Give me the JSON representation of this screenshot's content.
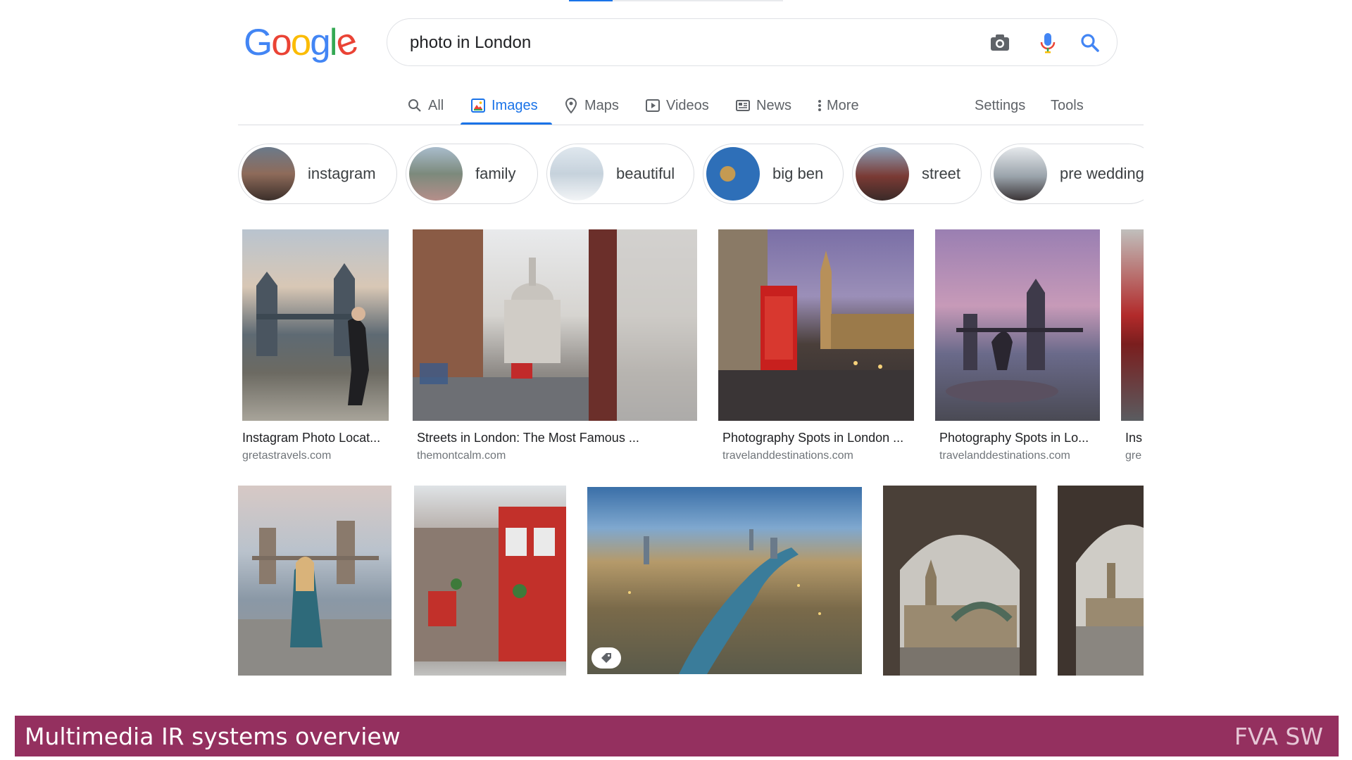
{
  "logo": {
    "letters": [
      {
        "ch": "G",
        "color": "#4285F4"
      },
      {
        "ch": "o",
        "color": "#EA4335"
      },
      {
        "ch": "o",
        "color": "#FBBC05"
      },
      {
        "ch": "g",
        "color": "#4285F4"
      },
      {
        "ch": "l",
        "color": "#34A853"
      },
      {
        "ch": "e",
        "color": "#EA4335"
      }
    ]
  },
  "search": {
    "query": "photo in London",
    "icons": [
      "camera-icon",
      "microphone-icon",
      "search-icon"
    ]
  },
  "tabs": [
    {
      "label": "All",
      "icon": "search-icon",
      "active": false
    },
    {
      "label": "Images",
      "icon": "image-icon",
      "active": true
    },
    {
      "label": "Maps",
      "icon": "map-pin-icon",
      "active": false
    },
    {
      "label": "Videos",
      "icon": "play-icon",
      "active": false
    },
    {
      "label": "News",
      "icon": "news-icon",
      "active": false
    },
    {
      "label": "More",
      "icon": "more-vertical-icon",
      "active": false
    }
  ],
  "tools": {
    "settings": "Settings",
    "tools": "Tools"
  },
  "chips": [
    "instagram",
    "family",
    "beautiful",
    "big ben",
    "street",
    "pre wedding"
  ],
  "results_row1": [
    {
      "title": "Instagram Photo Locat...",
      "site": "gretastravels.com"
    },
    {
      "title": "Streets in London: The Most Famous ...",
      "site": "themontcalm.com"
    },
    {
      "title": "Photography Spots in London ...",
      "site": "travelanddestinations.com"
    },
    {
      "title": "Photography Spots in Lo...",
      "site": "travelanddestinations.com"
    },
    {
      "title": "Ins",
      "site": "gre"
    }
  ],
  "footer": {
    "left": "Multimedia IR systems overview",
    "right": "FVA SW"
  },
  "colors": {
    "accent": "#1a73e8",
    "footer_bar": "#94305f"
  }
}
